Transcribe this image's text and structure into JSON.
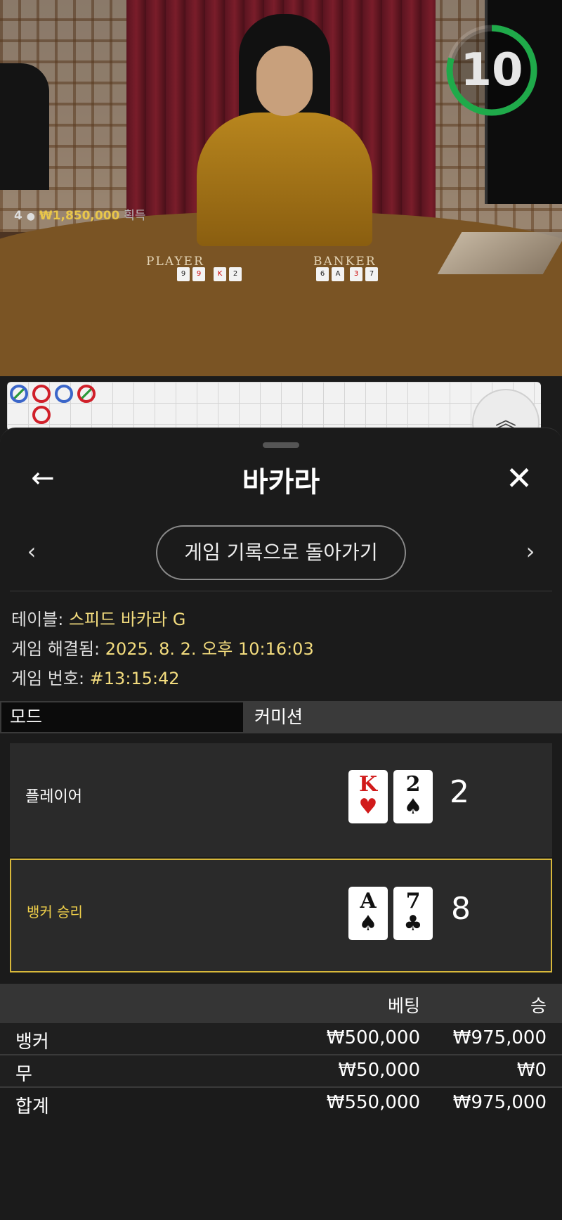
{
  "video": {
    "table_labels": {
      "player": "PLAYER",
      "banker": "BANKER"
    },
    "win_overlay": {
      "count": "4",
      "amount": "₩1,850,000",
      "suffix": "획득"
    },
    "timer": "10",
    "timer_color": "#1faa4a"
  },
  "roadmap": {
    "beads": [
      {
        "result": "player-tie",
        "color": "#3b66c9"
      },
      {
        "result": "banker",
        "color": "#d0202a"
      },
      {
        "result": "player",
        "color": "#3b66c9"
      },
      {
        "result": "banker-tie",
        "color": "#d0202a"
      },
      {
        "result": "banker",
        "color": "#d0202a"
      }
    ]
  },
  "sheet": {
    "title": "바카라",
    "history_button": "게임 기록으로 돌아가기",
    "info": {
      "table_label": "테이블: ",
      "table_value": "스피드 바카라 G",
      "resolved_label": "게임 해결됨: ",
      "resolved_value": "2025. 8. 2. 오후 10:16:03",
      "number_label": "게임 번호: ",
      "number_value": "#13:15:42"
    },
    "tabs": {
      "mode": "모드",
      "commission": "커미션"
    },
    "player": {
      "label": "플레이어",
      "cards": [
        {
          "rank": "K",
          "suit": "♥",
          "color": "red"
        },
        {
          "rank": "2",
          "suit": "♠",
          "color": "black"
        }
      ],
      "score": "2"
    },
    "banker": {
      "label": "뱅커 승리",
      "cards": [
        {
          "rank": "A",
          "suit": "♠",
          "color": "black"
        },
        {
          "rank": "7",
          "suit": "♣",
          "color": "black"
        }
      ],
      "score": "8"
    },
    "bets": {
      "header_bet": "베팅",
      "header_win": "승",
      "rows": [
        {
          "name": "뱅커",
          "bet": "₩500,000",
          "win": "₩975,000"
        },
        {
          "name": "무",
          "bet": "₩50,000",
          "win": "₩0"
        }
      ],
      "total": {
        "name": "합계",
        "bet": "₩550,000",
        "win": "₩975,000"
      }
    }
  },
  "colors": {
    "accent_gold": "#f0d04a",
    "info_value": "#f3dc7e",
    "timer_green": "#1faa4a"
  }
}
